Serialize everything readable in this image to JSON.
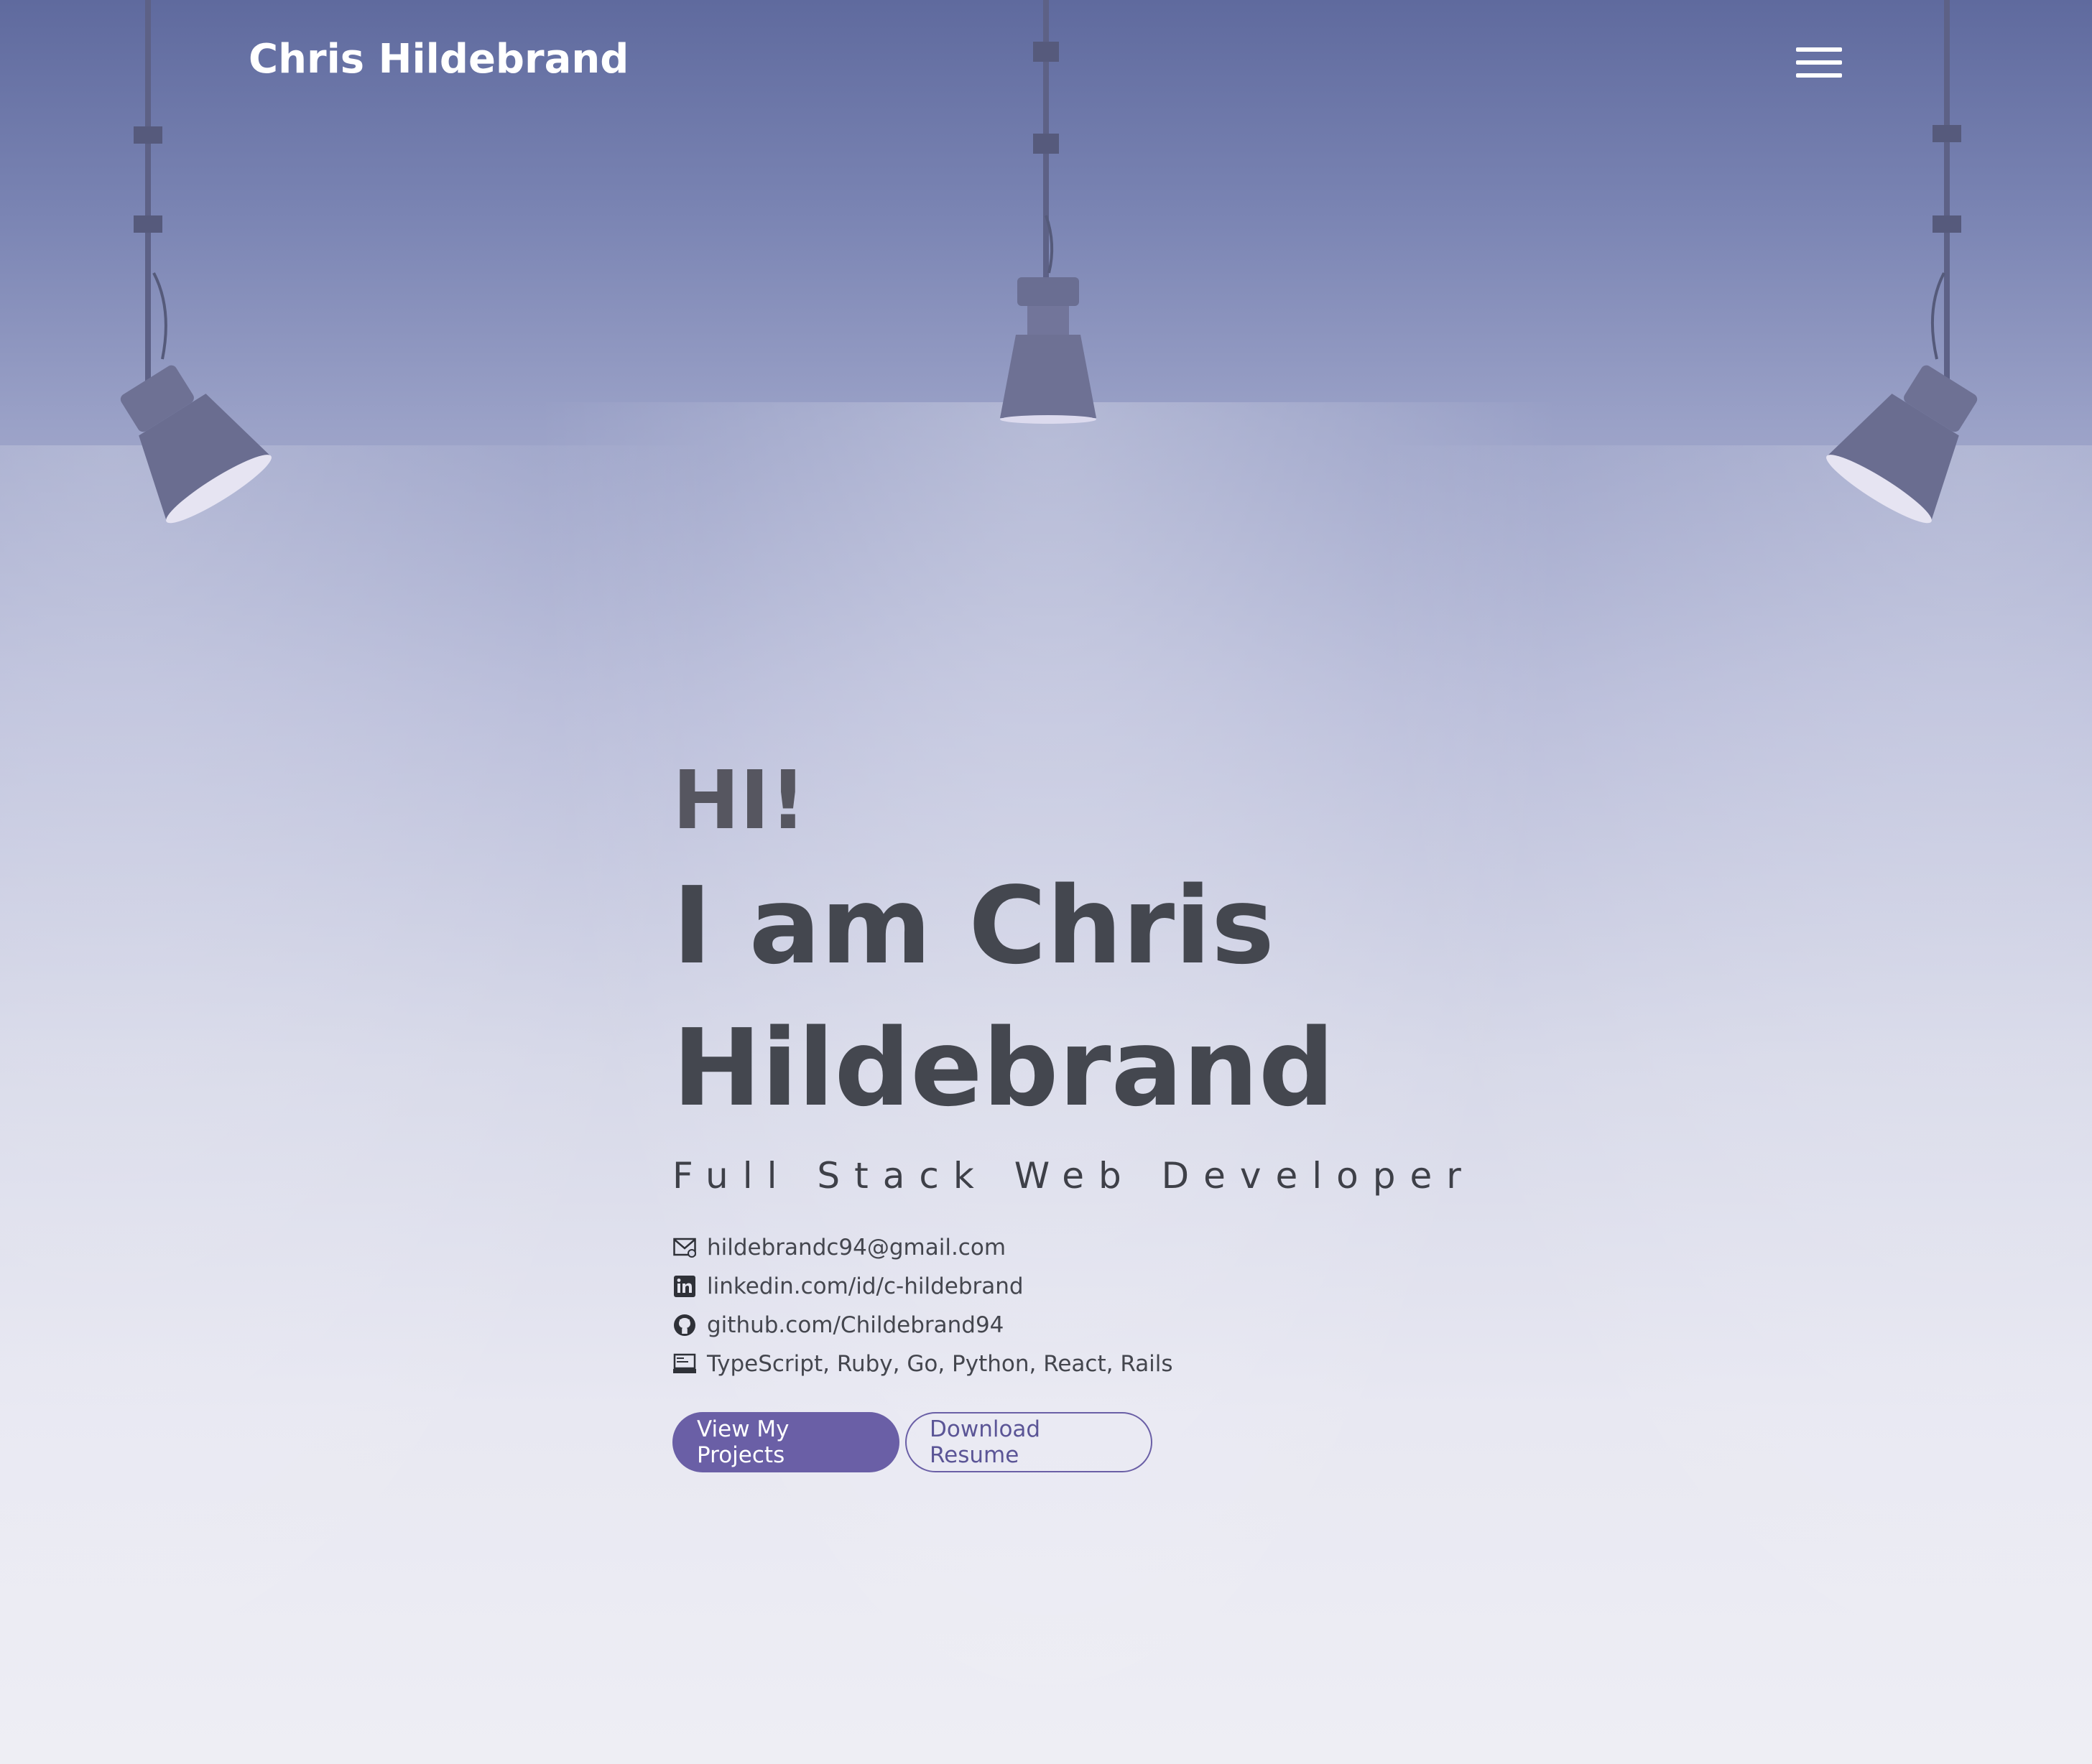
{
  "header": {
    "brand": "Chris Hildebrand",
    "menu_icon": "hamburger-menu-icon"
  },
  "hero": {
    "greeting": "HI!",
    "name": "I am Chris Hildebrand",
    "role": "Full Stack Web Developer",
    "contacts": [
      {
        "icon": "email-icon",
        "text": "hildebrandc94@gmail.com"
      },
      {
        "icon": "linkedin-icon",
        "text": "linkedin.com/id/c-hildebrand"
      },
      {
        "icon": "github-icon",
        "text": "github.com/Childebrand94"
      },
      {
        "icon": "laptop-icon",
        "text": "TypeScript, Ruby, Go, Python, React, Rails"
      }
    ],
    "buttons": {
      "primary": "View My Projects",
      "secondary": "Download Resume"
    }
  },
  "colors": {
    "accent": "#6a5fa6",
    "heading": "#44474f",
    "background_top": "#5f6a9e",
    "background_bottom": "#eeeef4"
  }
}
